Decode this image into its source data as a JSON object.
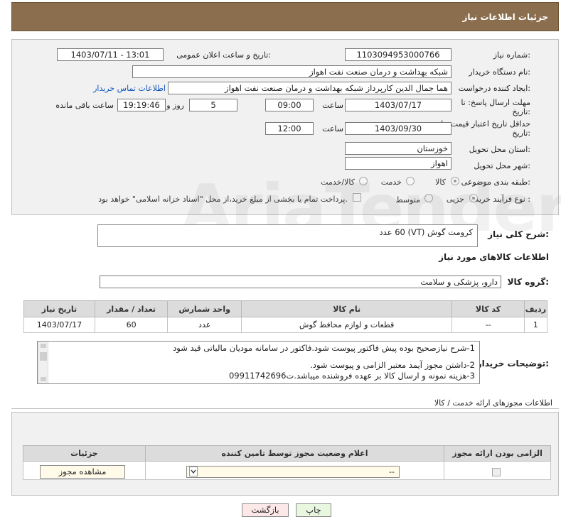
{
  "header": {
    "title": "جزئیات اطلاعات نیاز"
  },
  "form": {
    "need_number_label": "شماره نیاز:",
    "need_number": "1103094953000766",
    "announce_label": "تاریخ و ساعت اعلان عمومی:",
    "announce_value": "1403/07/11 - 13:01",
    "buyer_label": "نام دستگاه خریدار:",
    "buyer_value": "شبکه بهداشت و درمان صنعت نفت اهواز",
    "requester_label": "ایجاد کننده درخواست:",
    "requester_value": "هما جمال الدین کارپرداز شبکه بهداشت و درمان صنعت نفت اهواز",
    "contact_link": "اطلاعات تماس خریدار",
    "deadline_label_1": "مهلت ارسال پاسخ: تا",
    "deadline_label_2": "تاریخ:",
    "deadline_date": "1403/07/17",
    "time_label": "ساعت",
    "deadline_time": "09:00",
    "days_value": "5",
    "days_label": "روز و",
    "remaining_time": "19:19:46",
    "remaining_label": "ساعت باقی مانده",
    "validity_label_1": "حداقل تاریخ اعتبار قیمت: تا",
    "validity_label_2": "تاریخ:",
    "validity_date": "1403/09/30",
    "validity_time": "12:00",
    "province_label": "استان محل تحویل:",
    "province_value": "خوزستان",
    "city_label": "شهر محل تحویل:",
    "city_value": "اهواز",
    "category_label": "طبقه بندی موضوعی:",
    "category_options": [
      "کالا",
      "خدمت",
      "کالا/خدمت"
    ],
    "process_label": "نوع فرآیند خرید :",
    "process_options": [
      "جزیی",
      "متوسط"
    ],
    "payment_note": "پرداخت تمام یا بخشی از مبلغ خرید،از محل \"اسناد خزانه اسلامی\" خواهد بود."
  },
  "summary": {
    "label": "شرح کلی نیاز:",
    "value": "کرومت گوش (VT) 60 عدد"
  },
  "goods": {
    "section_title": "اطلاعات کالاهای مورد نیاز",
    "group_label": "گروه کالا:",
    "group_value": "دارو، پزشکی و سلامت",
    "columns": [
      "ردیف",
      "کد کالا",
      "نام کالا",
      "واحد شمارش",
      "تعداد / مقدار",
      "تاریخ نیاز"
    ],
    "rows": [
      [
        "1",
        "--",
        "قطعات و لوازم محافظ گوش",
        "عدد",
        "60",
        "1403/07/17"
      ]
    ]
  },
  "buyer_notes": {
    "label": "توضیحات خریدار:",
    "lines": [
      "1-شرح نیازصحیح بوده پیش فاکتور پیوست شود.فاکتور در سامانه مودیان مالیاتی قید شود",
      "",
      "2-داشتن مجوز آیمد معتبر الزامی و پیوست شود.",
      "3-هزینه  نمونه و ارسال کالا بر عهده فروشنده میباشد.ت09911742696"
    ]
  },
  "permits": {
    "title": "اطلاعات مجوزهای ارائه خدمت / کالا",
    "columns": [
      "الزامی بودن ارائه مجوز",
      "اعلام وضعیت مجوز توسط تامین کننده",
      "جزئیات"
    ],
    "select_value": "--",
    "view_button": "مشاهده مجوز"
  },
  "footer": {
    "print_button": "چاپ",
    "back_button": "بازگشت"
  },
  "watermark": "AriaTender.neT"
}
